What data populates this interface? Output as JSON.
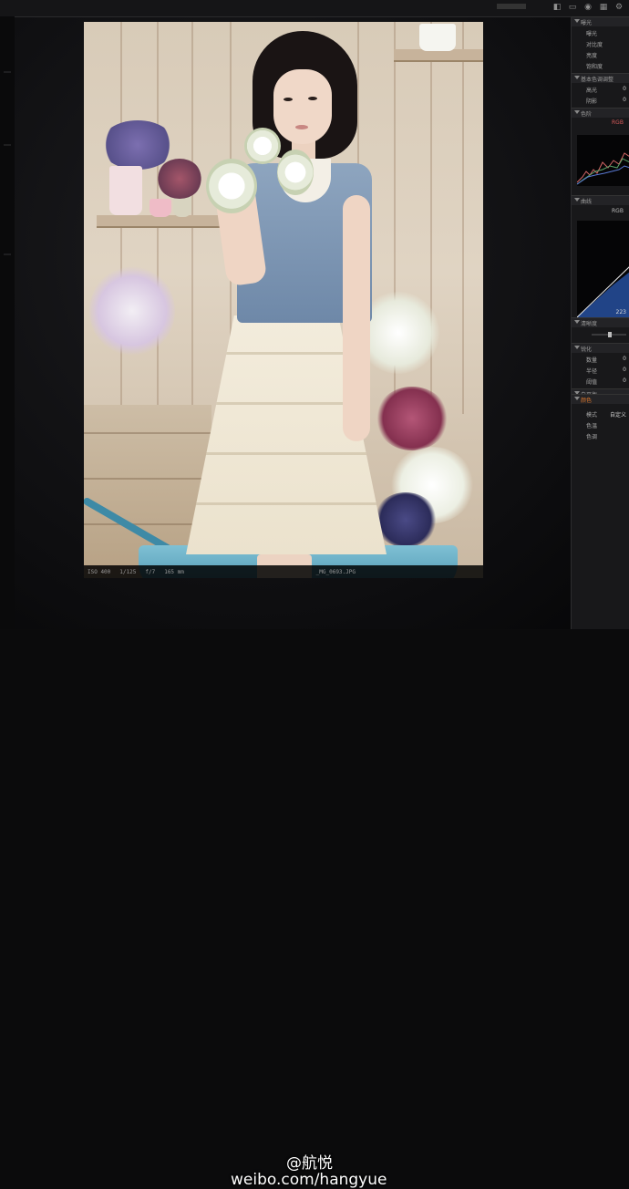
{
  "panel": {
    "sections": [
      {
        "label": "曝光"
      },
      {
        "label": "基本色调调整"
      },
      {
        "label": "色阶"
      },
      {
        "label": "曲线"
      },
      {
        "label": "清晰度"
      },
      {
        "label": "锐化"
      },
      {
        "label": "白平衡"
      },
      {
        "label": "颜色"
      }
    ],
    "rows_top": [
      {
        "label": "曝光",
        "value": ""
      },
      {
        "label": "对比度",
        "value": ""
      },
      {
        "label": "亮度",
        "value": ""
      },
      {
        "label": "饱和度",
        "value": ""
      }
    ],
    "rows_mid": [
      {
        "label": "高光",
        "value": "0"
      },
      {
        "label": "阴影",
        "value": "0"
      }
    ],
    "rows_sharp": [
      {
        "label": "数量",
        "value": "0"
      },
      {
        "label": "半径",
        "value": "0"
      },
      {
        "label": "阈值",
        "value": "0"
      }
    ],
    "rows_color": [
      {
        "label": "模式",
        "value": "自定义"
      },
      {
        "label": "色温",
        "value": ""
      },
      {
        "label": "色调",
        "value": ""
      }
    ],
    "histogram_label": "RGB",
    "curves_channel": "RGB",
    "curves_value": "223"
  },
  "viewer": {
    "status": [
      "ISO 400",
      "1/125",
      "f/7",
      "165 mm"
    ],
    "filename": "_MG_0693.JPG"
  },
  "watermark": {
    "name": "@航悦",
    "url": "weibo.com/hangyue"
  },
  "colors": {
    "panel_bg": "#18181a",
    "accent": "#3b6fd6",
    "wheelbarrow": "#5fa9c2"
  }
}
